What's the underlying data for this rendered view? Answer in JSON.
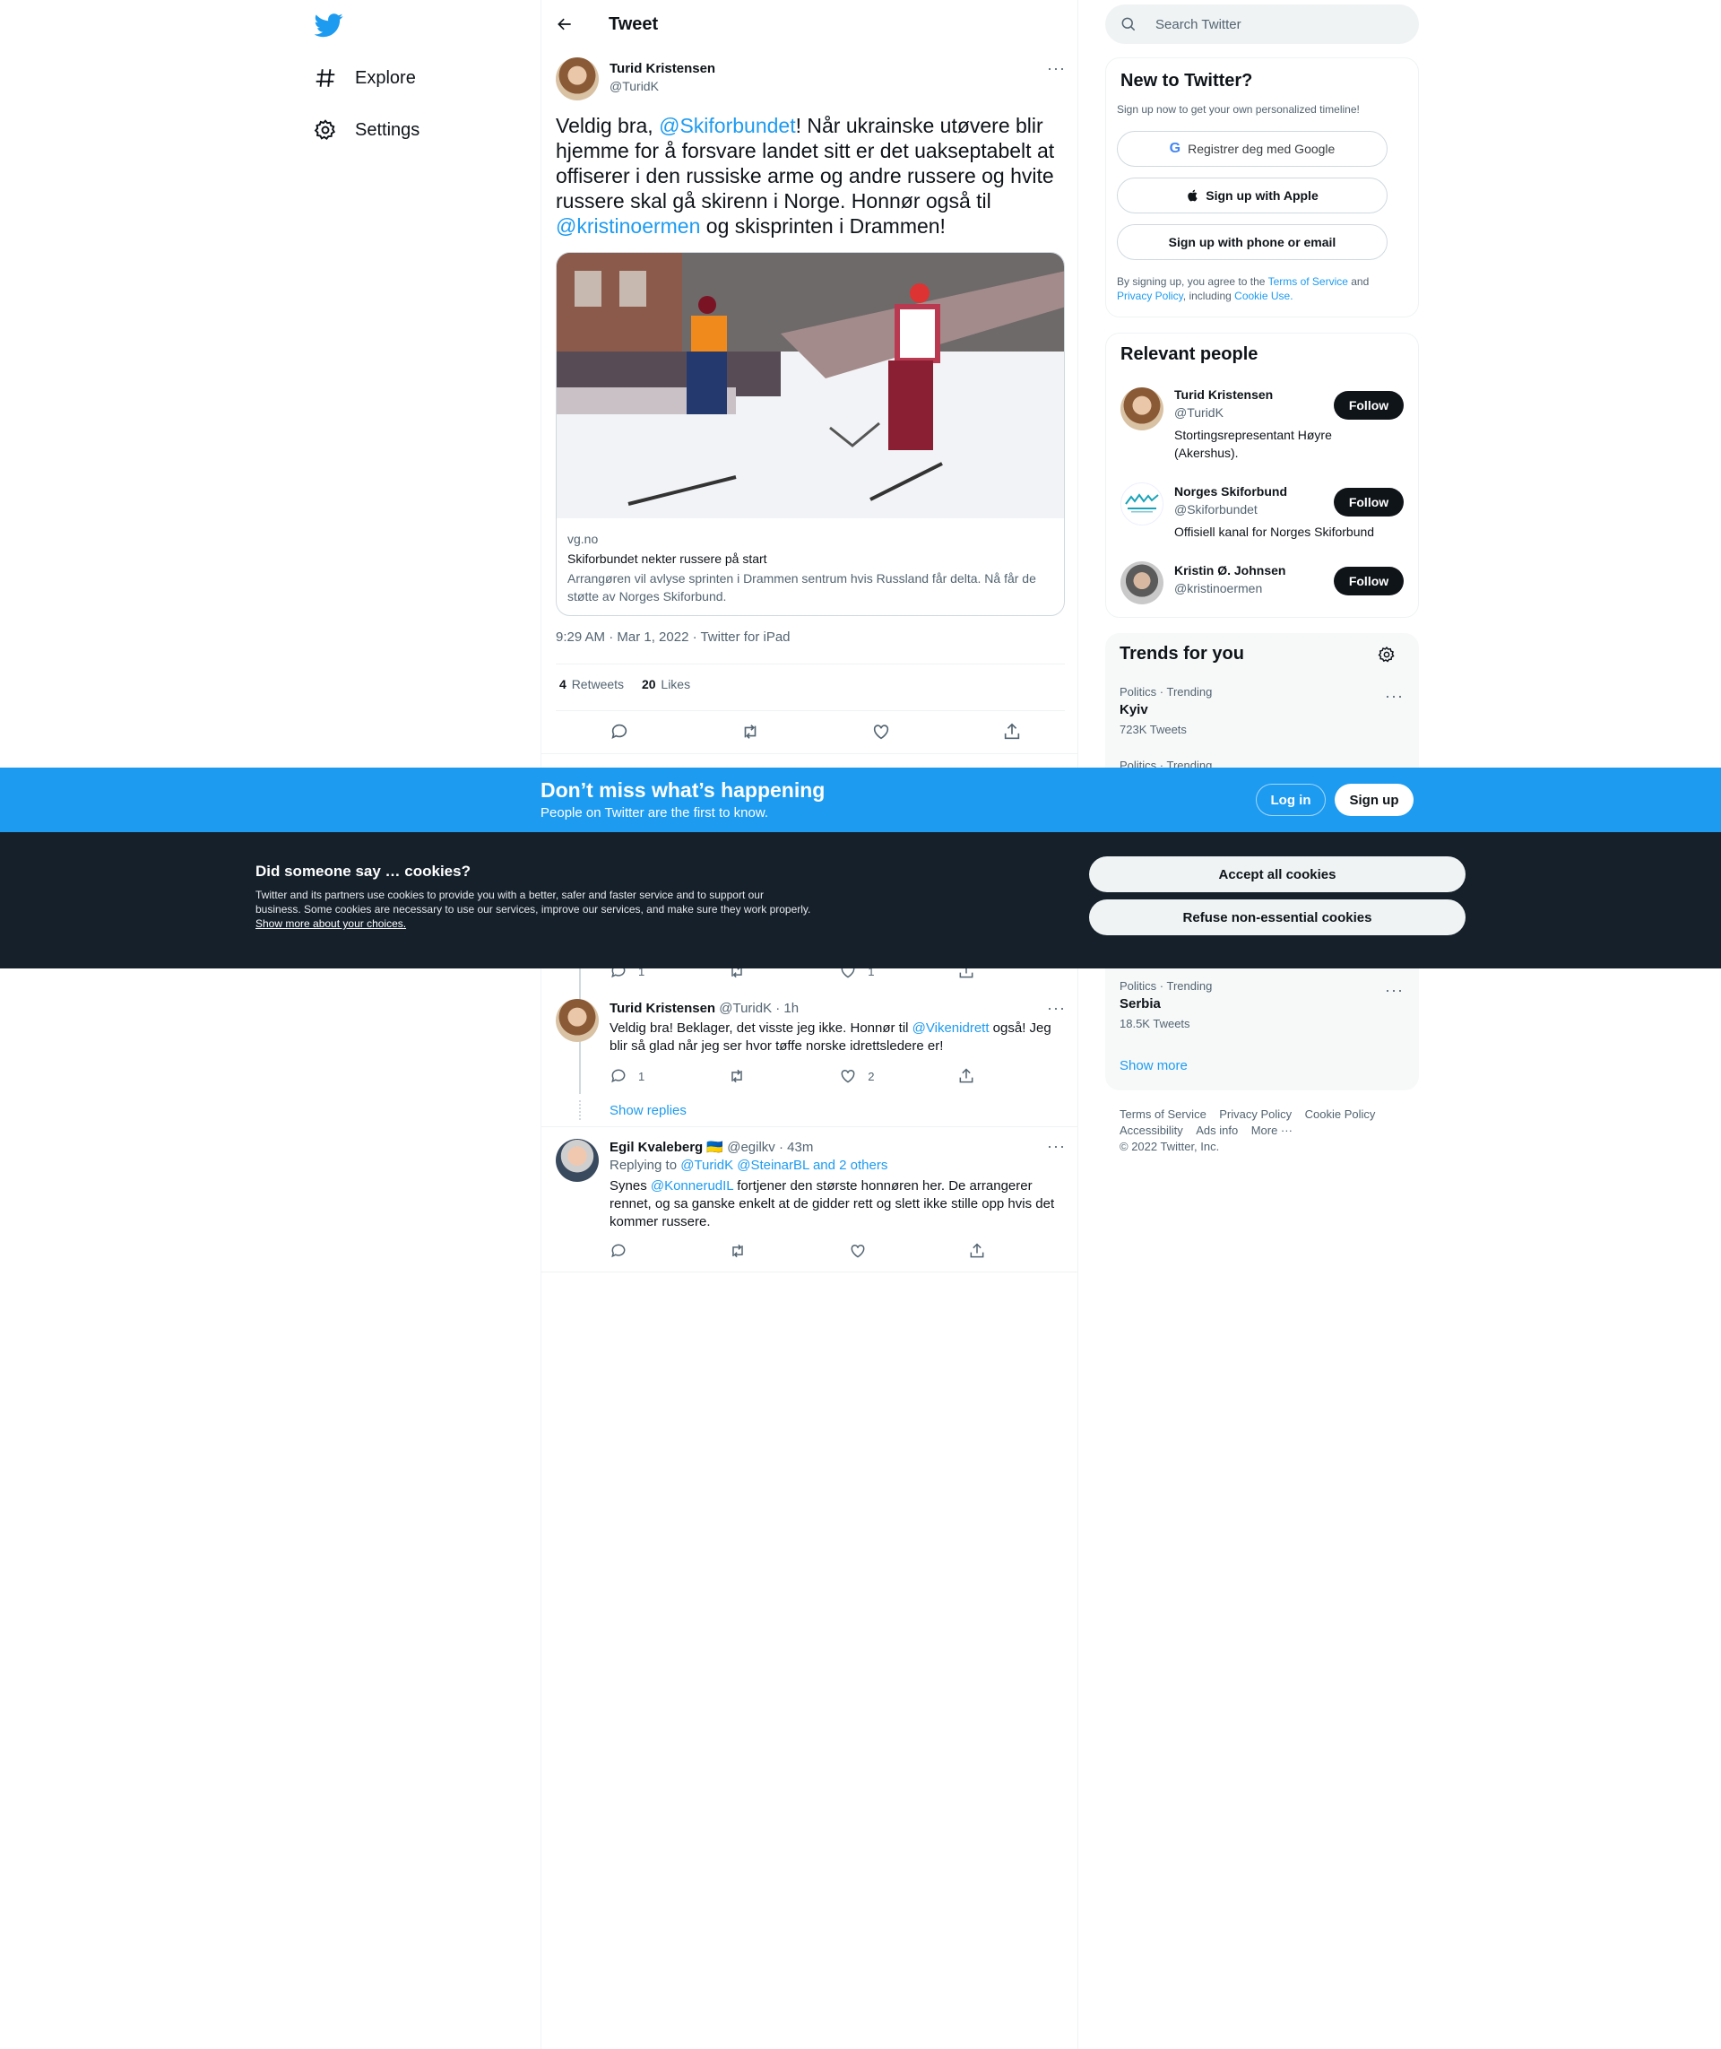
{
  "nav": {
    "items": [
      {
        "label": "Explore",
        "icon": "hashtag-icon"
      },
      {
        "label": "Settings",
        "icon": "gear-icon"
      }
    ]
  },
  "header": {
    "title": "Tweet"
  },
  "tweet": {
    "author_name": "Turid Kristensen",
    "author_handle": "@TuridK",
    "text_parts": [
      "Veldig bra, ",
      "@Skiforbundet",
      "! Når ukrainske utøvere blir hjemme for å forsvare landet sitt er det uakseptabelt at offiserer i den russiske arme og andre russere og hvite russere skal gå skirenn i Norge. Honnør også til ",
      "@kristinoermen",
      " og skisprinten i Drammen!"
    ],
    "card": {
      "domain": "vg.no",
      "title": "Skiforbundet nekter russere på start",
      "description": "Arrangøren vil avlyse sprinten i Drammen sentrum hvis Russland får delta. Nå får de støtte av Norges Skiforbund."
    },
    "timestamp": "9:29 AM · Mar 1, 2022 · Twitter for iPad",
    "retweets_count": "4",
    "retweets_label": "Retweets",
    "likes_count": "20",
    "likes_label": "Likes"
  },
  "partial_reply": {
    "reply_count": "1",
    "like_count": "1"
  },
  "reply1": {
    "author_name": "Turid Kristensen",
    "author_handle": "@TuridK · 1h",
    "text_before": "Veldig bra! Beklager, det visste jeg ikke. Honnør til ",
    "mention": "@Vikenidrett",
    "text_after": " også! Jeg blir så glad når jeg ser hvor tøffe norske idrettsledere er!",
    "reply_count": "1",
    "like_count": "2"
  },
  "show_replies": "Show replies",
  "reply2": {
    "author_name": "Egil Kvaleberg",
    "flag": "🇺🇦",
    "author_handle": "@egilkv · 43m",
    "replying_prefix": "Replying to ",
    "replying_targets": "@TuridK @SteinarBL and 2 others",
    "text_before": "Synes ",
    "mention": "@KonnerudIL",
    "text_after": " fortjener den største honnøren her. De arrangerer rennet, og sa ganske enkelt at de gidder rett og slett ikke stille opp hvis det kommer russere."
  },
  "search": {
    "placeholder": "Search Twitter"
  },
  "new_to_twitter": {
    "title": "New to Twitter?",
    "subtitle": "Sign up now to get your own personalized timeline!",
    "google_label": "Registrer deg med Google",
    "apple_label": "Sign up with Apple",
    "phone_label": "Sign up with phone or email",
    "legal_prefix": "By signing up, you agree to the ",
    "terms": "Terms of Service",
    "and": " and ",
    "privacy": "Privacy Policy",
    "including": ", including ",
    "cookie_use": "Cookie Use."
  },
  "relevant_people": {
    "title": "Relevant people",
    "follow_label": "Follow",
    "people": [
      {
        "name": "Turid Kristensen",
        "handle": "@TuridK",
        "bio": "Stortingsrepresentant Høyre (Akershus)."
      },
      {
        "name": "Norges Skiforbund",
        "handle": "@Skiforbundet",
        "bio": "Offisiell kanal for Norges Skiforbund"
      },
      {
        "name": "Kristin Ø. Johnsen",
        "handle": "@kristinoermen",
        "bio": ""
      }
    ]
  },
  "trends": {
    "title": "Trends for you",
    "items": [
      {
        "meta": "Politics · Trending",
        "name": "Kyiv",
        "count": "723K Tweets"
      },
      {
        "meta": "Politics · Trending",
        "name": "Serbia",
        "count": "18.5K Tweets"
      }
    ],
    "partial_meta": "Politics · Trending",
    "show_more": "Show more"
  },
  "footer": {
    "links_row1": [
      "Terms of Service",
      "Privacy Policy",
      "Cookie Policy"
    ],
    "links_row2": [
      "Accessibility",
      "Ads info",
      "More ···"
    ],
    "copyright": "© 2022 Twitter, Inc."
  },
  "banner": {
    "title": "Don’t miss what’s happening",
    "subtitle": "People on Twitter are the first to know.",
    "login_label": "Log in",
    "signup_label": "Sign up"
  },
  "cookies": {
    "title": "Did someone say … cookies?",
    "body": "Twitter and its partners use cookies to provide you with a better, safer and faster service and to support our business. Some cookies are necessary to use our services, improve our services, and make sure they work properly. ",
    "link": "Show more about your choices.",
    "accept_label": "Accept all cookies",
    "refuse_label": "Refuse non-essential cookies"
  },
  "colors": {
    "accent": "#1d9bf0",
    "text": "#0f1419",
    "muted": "#536471",
    "dark_overlay": "#15202b"
  }
}
